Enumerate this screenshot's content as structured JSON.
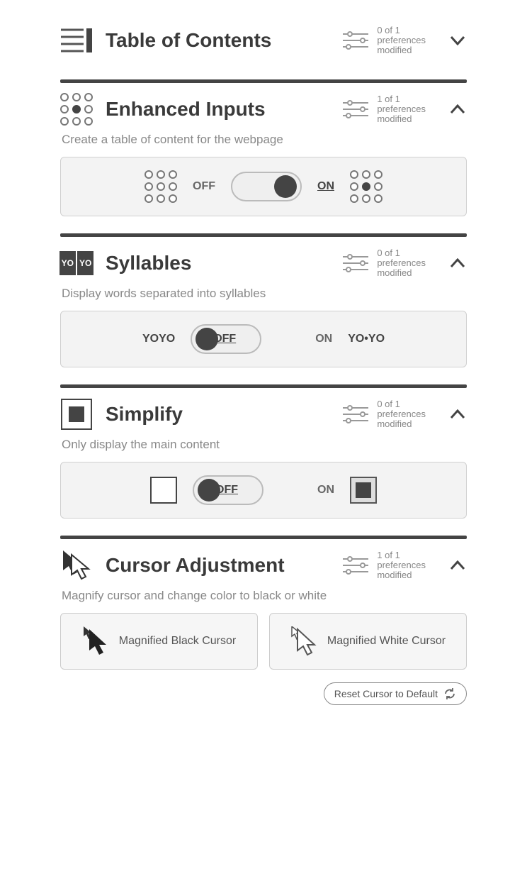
{
  "common": {
    "off": "OFF",
    "on": "ON",
    "prefs_line2": "preferences",
    "prefs_line3": "modified"
  },
  "sections": {
    "toc": {
      "title": "Table of Contents",
      "prefs_count": "0 of 1",
      "expanded": false
    },
    "inputs": {
      "title": "Enhanced Inputs",
      "prefs_count": "1 of 1",
      "desc": "Create a table of content for the webpage",
      "toggle_state": "on"
    },
    "syllables": {
      "title": "Syllables",
      "prefs_count": "0 of 1",
      "desc": "Display words separated into syllables",
      "left_example": "YOYO",
      "right_example": "YO•YO",
      "toggle_state": "off"
    },
    "simplify": {
      "title": "Simplify",
      "prefs_count": "0 of 1",
      "desc": "Only display the main content",
      "toggle_state": "off"
    },
    "cursor": {
      "title": "Cursor Adjustment",
      "prefs_count": "1 of 1",
      "desc": "Magnify cursor and change color to black or white",
      "option_black": "Magnified Black Cursor",
      "option_white": "Magnified White Cursor",
      "reset": "Reset Cursor to Default"
    }
  }
}
